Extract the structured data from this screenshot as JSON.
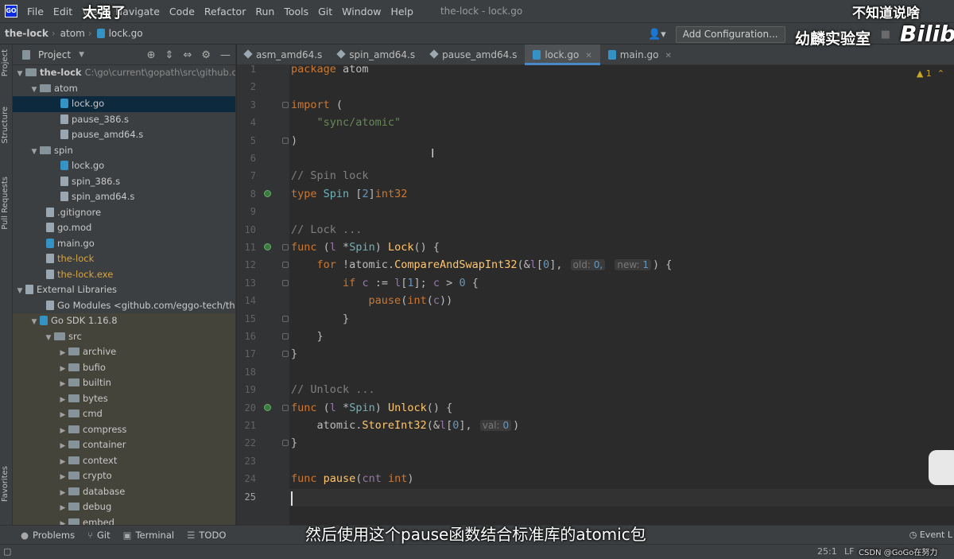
{
  "menubar": {
    "items": [
      "File",
      "Edit",
      "View",
      "Navigate",
      "Code",
      "Refactor",
      "Run",
      "Tools",
      "Git",
      "Window",
      "Help"
    ],
    "window_title": "the-lock - lock.go"
  },
  "navbar": {
    "crumbs": [
      "the-lock",
      "atom",
      "lock.go"
    ],
    "add_configuration": "Add Configuration..."
  },
  "left_stripe": {
    "tabs": [
      "Project",
      "Structure",
      "Pull Requests",
      "Favorites"
    ]
  },
  "project_panel": {
    "title": "Project",
    "tree": [
      {
        "label": "the-lock",
        "extra": "C:\\go\\current\\gopath\\src\\github.co"
      },
      {
        "label": "atom"
      },
      {
        "label": "lock.go"
      },
      {
        "label": "pause_386.s"
      },
      {
        "label": "pause_amd64.s"
      },
      {
        "label": "spin"
      },
      {
        "label": "lock.go"
      },
      {
        "label": "spin_386.s"
      },
      {
        "label": "spin_amd64.s"
      },
      {
        "label": ".gitignore"
      },
      {
        "label": "go.mod"
      },
      {
        "label": "main.go"
      },
      {
        "label": "the-lock"
      },
      {
        "label": "the-lock.exe"
      },
      {
        "label": "External Libraries"
      },
      {
        "label": "Go Modules <github.com/eggo-tech/the-l"
      },
      {
        "label": "Go SDK 1.16.8"
      },
      {
        "label": "src"
      },
      {
        "label": "archive"
      },
      {
        "label": "bufio"
      },
      {
        "label": "builtin"
      },
      {
        "label": "bytes"
      },
      {
        "label": "cmd"
      },
      {
        "label": "compress"
      },
      {
        "label": "container"
      },
      {
        "label": "context"
      },
      {
        "label": "crypto"
      },
      {
        "label": "database"
      },
      {
        "label": "debug"
      },
      {
        "label": "embed"
      }
    ]
  },
  "editor_tabs": [
    "asm_amd64.s",
    "spin_amd64.s",
    "pause_amd64.s",
    "lock.go",
    "main.go"
  ],
  "editor": {
    "warning_badge": "1",
    "line_numbers": [
      "1",
      "2",
      "3",
      "4",
      "5",
      "6",
      "7",
      "8",
      "9",
      "10",
      "11",
      "12",
      "13",
      "14",
      "15",
      "16",
      "17",
      "18",
      "19",
      "20",
      "21",
      "22",
      "23",
      "24",
      "25"
    ],
    "hints": {
      "old": "old:",
      "old_val": "0,",
      "new": "new:",
      "new_val": "1",
      "val": "val:",
      "val_val": "0"
    }
  },
  "bottom_bar": {
    "tools": [
      "Problems",
      "Git",
      "Terminal",
      "TODO"
    ],
    "event_log": "Event L"
  },
  "status_bar": {
    "caret_position": "25:1",
    "line_ending": "LF"
  },
  "overlays": {
    "caption_top_left": "太强了",
    "caption_top_right": "不知道说啥",
    "channel_name": "幼麟实验室",
    "platform_logo": "Bilib",
    "subtitle": "然后使用这个pause函数结合标准库的atomic包",
    "watermark": "CSDN @GoGo在努力"
  }
}
